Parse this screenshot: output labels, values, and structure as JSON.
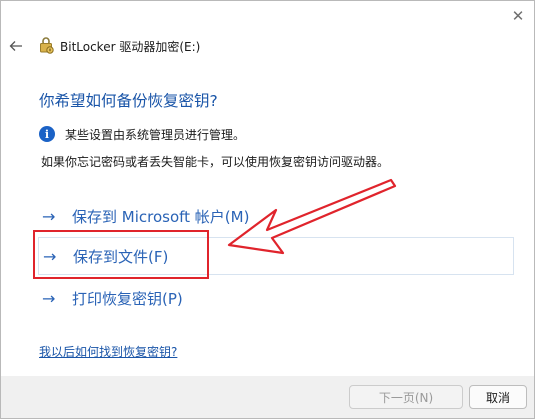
{
  "window": {
    "title": "BitLocker 驱动器加密(E:)",
    "close_glyph": "✕"
  },
  "page": {
    "heading": "你希望如何备份恢复密钥?",
    "admin_note": "某些设置由系统管理员进行管理。",
    "description": "如果你忘记密码或者丢失智能卡，可以使用恢复密钥访问驱动器。",
    "options": [
      {
        "arrow": "→",
        "label": "保存到 Microsoft 帐户(M)"
      },
      {
        "arrow": "→",
        "label": "保存到文件(F)"
      },
      {
        "arrow": "→",
        "label": "打印恢复密钥(P)"
      }
    ],
    "help_link": "我以后如何找到恢复密钥?"
  },
  "footer": {
    "next_label": "下一页(N)",
    "cancel_label": "取消"
  },
  "colors": {
    "accent": "#1a55a8",
    "link": "#2a63b6",
    "annotation_red": "#e0242c",
    "info_icon": "#1b62c6"
  },
  "icons": {
    "back": "back-arrow-icon",
    "app": "bitlocker-key-icon",
    "info": "info-icon",
    "close": "close-icon"
  }
}
